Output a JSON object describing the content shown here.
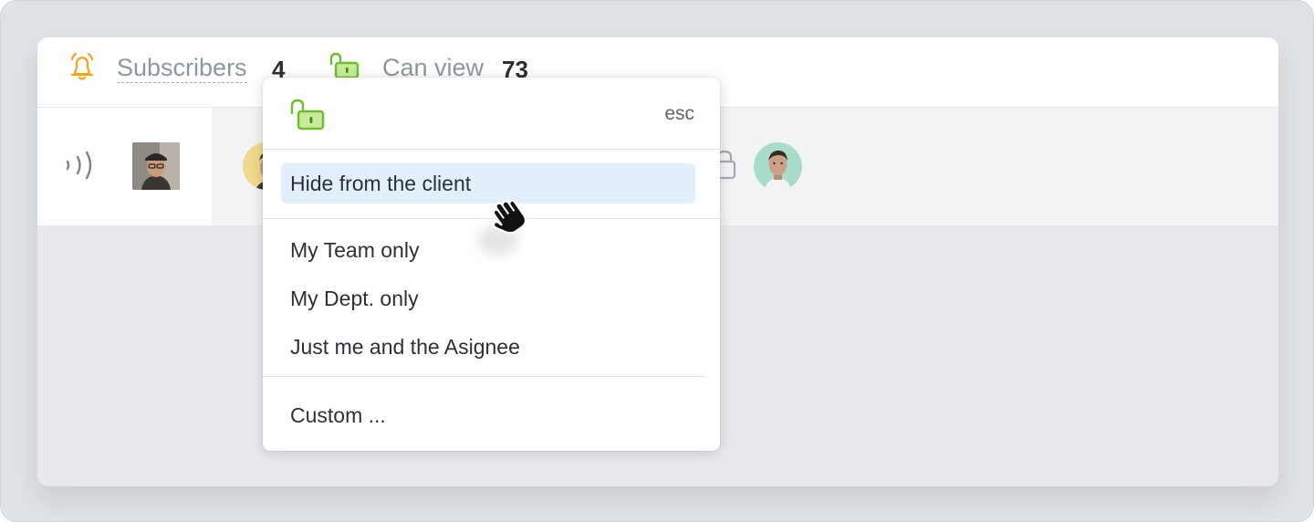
{
  "header": {
    "subscribers_label": "Subscribers",
    "subscribers_count": "4",
    "can_view_label": "Can view",
    "can_view_count": "73"
  },
  "icons": {
    "bell": "bell-icon",
    "unlock": "unlock-icon",
    "signal": "signal-icon",
    "lock": "lock-icon",
    "pointer": "hand-pointer-icon"
  },
  "colors": {
    "bell": "#f5a31a",
    "lock_green": "#6abf2a",
    "lock_fill": "#c9ea9a",
    "highlight": "#e3f0fb"
  },
  "dropdown": {
    "esc_label": "esc",
    "items": [
      {
        "label": "Hide from the client",
        "highlighted": true
      },
      {
        "label": "My Team only"
      },
      {
        "label": "My Dept. only"
      },
      {
        "label": "Just me and the Asignee"
      },
      {
        "label": "Custom ..."
      }
    ]
  }
}
